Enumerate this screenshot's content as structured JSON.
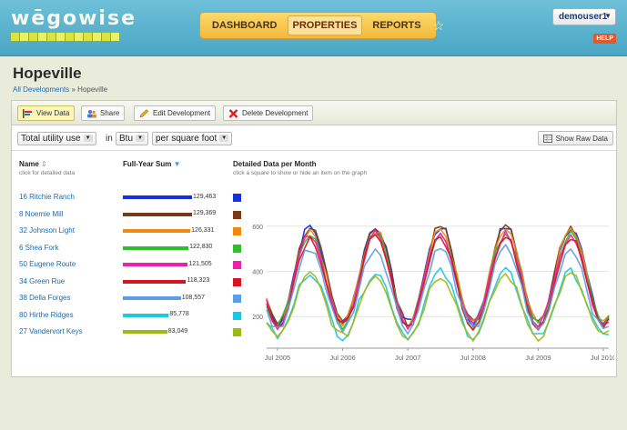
{
  "header": {
    "logo_text": "wēgowise",
    "nav": [
      {
        "label": "DASHBOARD",
        "active": false
      },
      {
        "label": "PROPERTIES",
        "active": true
      },
      {
        "label": "REPORTS",
        "active": false
      }
    ],
    "user": "demouser1",
    "help": "HELP"
  },
  "page": {
    "title": "Hopeville",
    "breadcrumb_link": "All Developments",
    "breadcrumb_sep": "»",
    "breadcrumb_current": "Hopeville"
  },
  "toolbar": {
    "view_data": "View Data",
    "share": "Share",
    "edit": "Edit Development",
    "delete": "Delete Development"
  },
  "filters": {
    "metric": "Total utility use",
    "in_label": "in",
    "unit": "Btu",
    "normalize": "per square foot",
    "raw_button": "Show Raw Data"
  },
  "columns": {
    "name": "Name",
    "name_sort": "⇕",
    "name_sub": "click for detailed data",
    "sum": "Full-Year Sum",
    "sum_sort": "▼",
    "detail": "Detailed Data per Month",
    "detail_sub": "click a square to show or hide an item on the graph"
  },
  "chart_data": {
    "type": "line",
    "x_ticks": [
      "Jul 2005",
      "Jul 2006",
      "Jul 2007",
      "Jul 2008",
      "Jul 2009",
      "Jul 2010"
    ],
    "y_ticks": [
      200,
      400,
      600
    ],
    "ylim": [
      60,
      760
    ],
    "grid": true,
    "series": [
      {
        "name": "16 Ritchie Ranch",
        "sum": "129,463",
        "sum_value": 129463,
        "color": "#1530e0"
      },
      {
        "name": "8 Noemie Mill",
        "sum": "129,369",
        "sum_value": 129369,
        "color": "#7a3a1a"
      },
      {
        "name": "32 Johnson Light",
        "sum": "126,331",
        "sum_value": 126331,
        "color": "#f08a12"
      },
      {
        "name": "6 Shea Fork",
        "sum": "122,830",
        "sum_value": 122830,
        "color": "#2fbf2a"
      },
      {
        "name": "50 Eugene Route",
        "sum": "121,505",
        "sum_value": 121505,
        "color": "#f01fb0"
      },
      {
        "name": "34 Green Rue",
        "sum": "118,323",
        "sum_value": 118323,
        "color": "#d61522"
      },
      {
        "name": "38 Della Forges",
        "sum": "108,557",
        "sum_value": 108557,
        "color": "#5aa0e0"
      },
      {
        "name": "80 Hirthe Ridges",
        "sum": "85,778",
        "sum_value": 85778,
        "color": "#1cc8e0"
      },
      {
        "name": "27 Vandervort Keys",
        "sum": "83,049",
        "sum_value": 83049,
        "color": "#a0b814"
      }
    ]
  }
}
